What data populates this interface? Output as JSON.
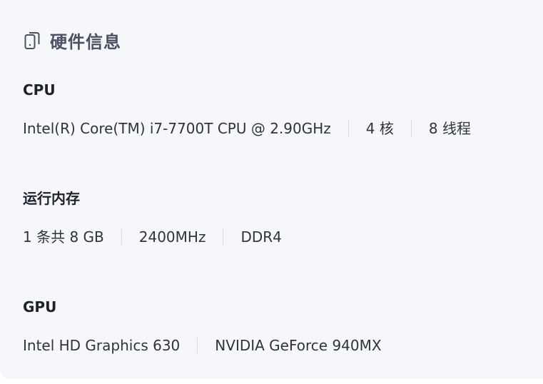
{
  "header": {
    "title": "硬件信息",
    "icon": "phone-icon"
  },
  "cpu": {
    "title": "CPU",
    "model": "Intel(R) Core(TM) i7-7700T CPU @ 2.90GHz",
    "cores": "4 核",
    "threads": "8 线程"
  },
  "memory": {
    "title": "运行内存",
    "size": "1 条共 8 GB",
    "speed": "2400MHz",
    "type": "DDR4"
  },
  "gpu": {
    "title": "GPU",
    "integrated": "Intel HD Graphics 630",
    "discrete": "NVIDIA GeForce 940MX"
  },
  "colors": {
    "card_background": "#f6f7fb",
    "title_color": "#4a5160",
    "text_color": "#2f333b",
    "divider_color": "#d8dbe3"
  }
}
